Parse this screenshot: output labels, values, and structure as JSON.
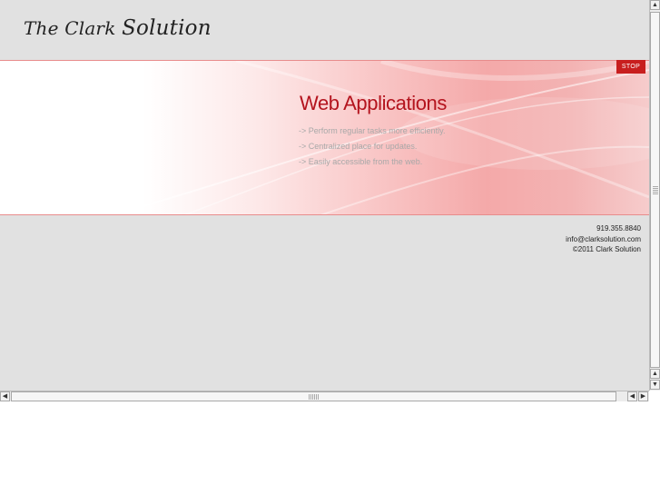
{
  "header": {
    "logo_the_clark": "The Clark ",
    "logo_solution": "Solution"
  },
  "banner": {
    "stop_label": "STOP",
    "title": "Web Applications",
    "bullets": [
      "-> Perform regular tasks more efficiently.",
      "-> Centralized place for updates.",
      "-> Easily accessible from the web."
    ]
  },
  "footer": {
    "phone": "919.355.8840",
    "email": "info@clarksolution.com",
    "copyright": "©2011 Clark Solution"
  },
  "icons": {
    "scroll_up": "up-arrow-icon",
    "scroll_down": "down-arrow-icon",
    "scroll_left": "left-arrow-icon",
    "scroll_right": "right-arrow-icon"
  },
  "colors": {
    "accent": "#c81e1e",
    "title": "#b4141e",
    "page_bg": "#e1e1e1"
  }
}
